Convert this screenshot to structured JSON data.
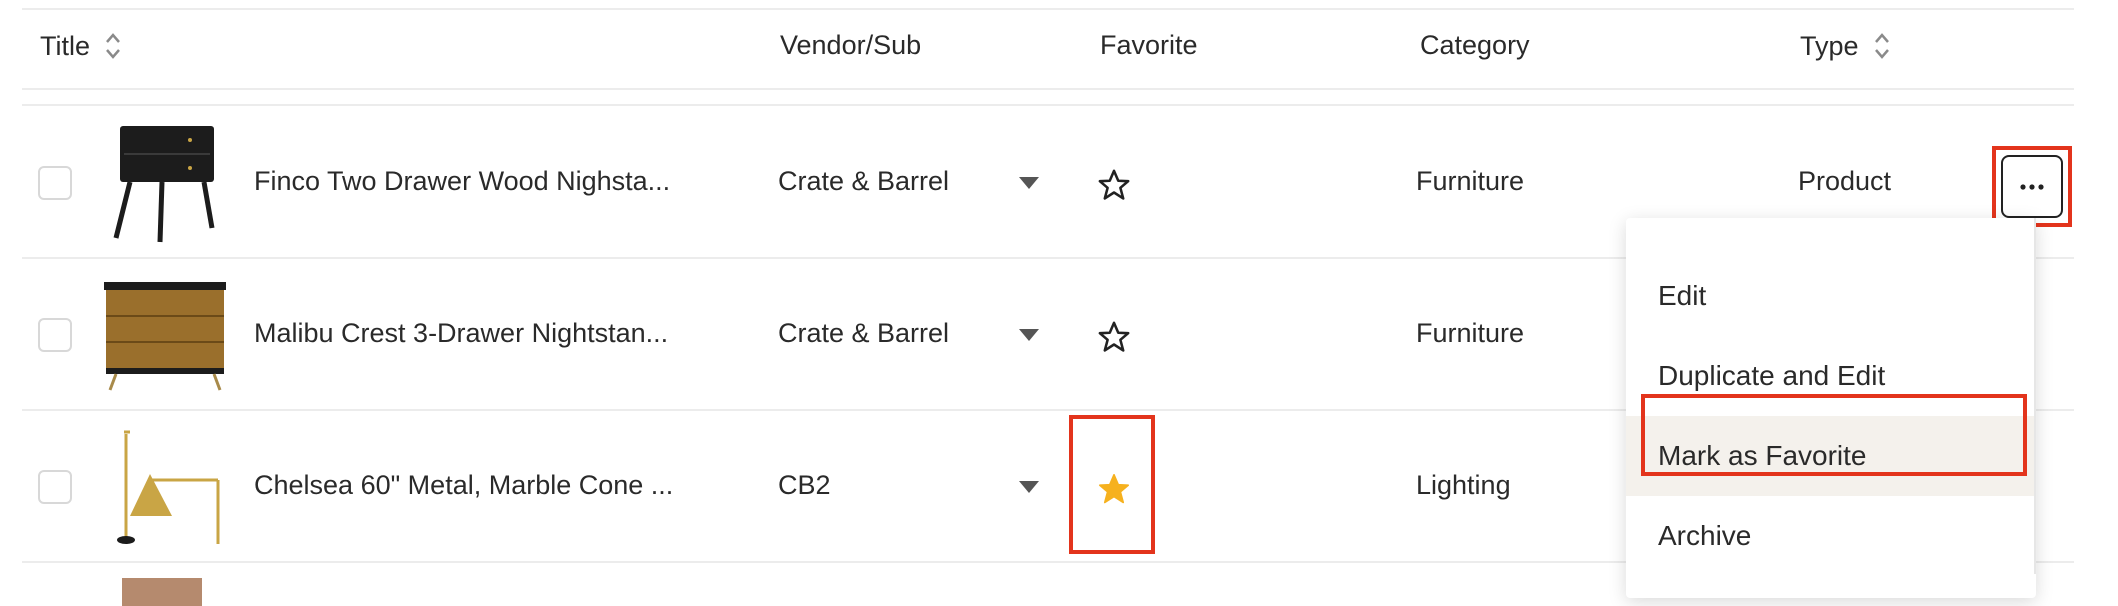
{
  "table": {
    "headers": {
      "title": "Title",
      "vendor": "Vendor/Sub",
      "favorite": "Favorite",
      "category": "Category",
      "type": "Type"
    },
    "rows": [
      {
        "title": "Finco Two Drawer Wood Nighsta...",
        "vendor": "Crate & Barrel",
        "favorite": false,
        "category": "Furniture",
        "type": "Product"
      },
      {
        "title": "Malibu Crest 3-Drawer Nightstan...",
        "vendor": "Crate & Barrel",
        "favorite": false,
        "category": "Furniture",
        "type": ""
      },
      {
        "title": "Chelsea 60\" Metal, Marble Cone ...",
        "vendor": "CB2",
        "favorite": true,
        "category": "Lighting",
        "type": ""
      }
    ]
  },
  "row_menu": {
    "items": [
      "Edit",
      "Duplicate and Edit",
      "Mark as Favorite",
      "Archive"
    ],
    "active_index": 2
  },
  "colors": {
    "highlight": "#e3341c",
    "star_filled": "#f6b11e",
    "menu_active_bg": "#f4f1ec"
  },
  "icons": [
    "sort-icon",
    "caret-down-icon",
    "star-outline-icon",
    "star-filled-icon",
    "more-icon"
  ]
}
